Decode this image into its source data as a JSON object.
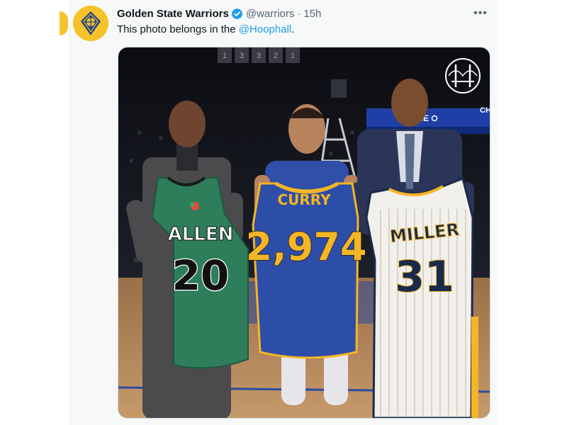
{
  "tweet": {
    "author": {
      "display_name": "Golden State Warriors",
      "handle": "@warriors",
      "verified": true,
      "avatar_icon": "warriors-logo-icon"
    },
    "separator": "·",
    "time": "15h",
    "more_label": "•••",
    "text_before": "This photo belongs in the ",
    "mention": "@Hoophall",
    "text_after": "."
  },
  "media": {
    "arena_sign": "CHASE",
    "arena_sign_right": "CH",
    "banners": [
      "1",
      "3",
      "3",
      "2",
      "1"
    ],
    "watermark_icon": "golden-gate-bridge-icon",
    "jerseys": [
      {
        "name": "ALLEN",
        "number": "20",
        "color": "#2e7d5b",
        "trim": "#ffffff"
      },
      {
        "name": "CURRY",
        "number": "2,974",
        "color": "#2d4ea8",
        "trim": "#f4b526"
      },
      {
        "name": "MILLER",
        "number": "31",
        "color": "#f2f0ea",
        "trim": "#1a2a4c"
      }
    ]
  },
  "colors": {
    "accent_link": "#1d9bf0",
    "warriors_gold": "#f6c22a",
    "warriors_blue": "#1d428a"
  }
}
